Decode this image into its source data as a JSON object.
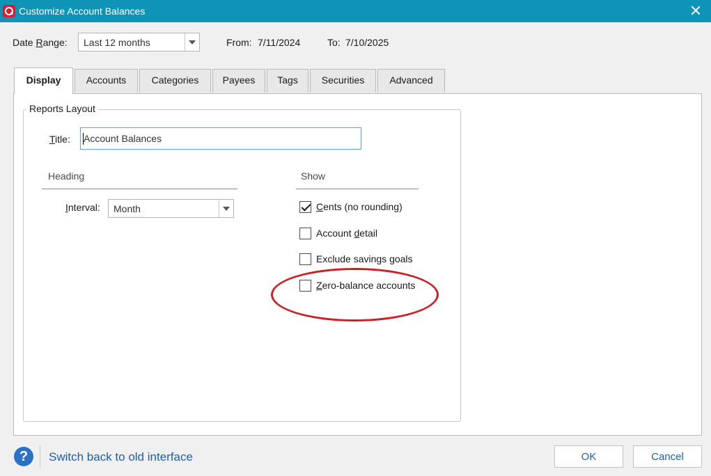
{
  "window": {
    "title": "Customize Account Balances",
    "logo_icon": "quicken-q-logo",
    "close_icon": "close-icon",
    "titlebar_color": "#0f94b8"
  },
  "date_range": {
    "label_prefix": "Date ",
    "label_underlined": "R",
    "label_suffix": "ange:",
    "selected": "Last 12 months",
    "from_label": "From:",
    "from_value": "7/11/2024",
    "to_label": "To:",
    "to_value": "7/10/2025"
  },
  "tabs": [
    {
      "label": "Display",
      "active": true
    },
    {
      "label": "Accounts",
      "active": false
    },
    {
      "label": "Categories",
      "active": false
    },
    {
      "label": "Payees",
      "active": false
    },
    {
      "label": "Tags",
      "active": false
    },
    {
      "label": "Securities",
      "active": false
    },
    {
      "label": "Advanced",
      "active": false
    }
  ],
  "reports_layout": {
    "legend": "Reports Layout",
    "title_label_underlined": "T",
    "title_label_rest": "itle:",
    "title_value": "Account Balances",
    "heading": {
      "section": "Heading",
      "interval_label_underlined": "I",
      "interval_label_rest": "nterval:",
      "interval_value": "Month"
    },
    "show": {
      "section": "Show",
      "options": [
        {
          "pre": "",
          "ul": "C",
          "post": "ents (no rounding)",
          "checked": true
        },
        {
          "pre": "Account ",
          "ul": "d",
          "post": "etail",
          "checked": false
        },
        {
          "pre": "Exclude savings ",
          "ul": "g",
          "post": "oals",
          "checked": false
        },
        {
          "pre": "",
          "ul": "Z",
          "post": "ero-balance accounts",
          "checked": false
        }
      ]
    }
  },
  "annotation": {
    "color": "#cc2027",
    "highlights": "Zero-balance accounts"
  },
  "footer": {
    "help_icon": "question-mark-icon",
    "help_glyph": "?",
    "link": "Switch back to old interface",
    "ok": "OK",
    "cancel": "Cancel"
  }
}
